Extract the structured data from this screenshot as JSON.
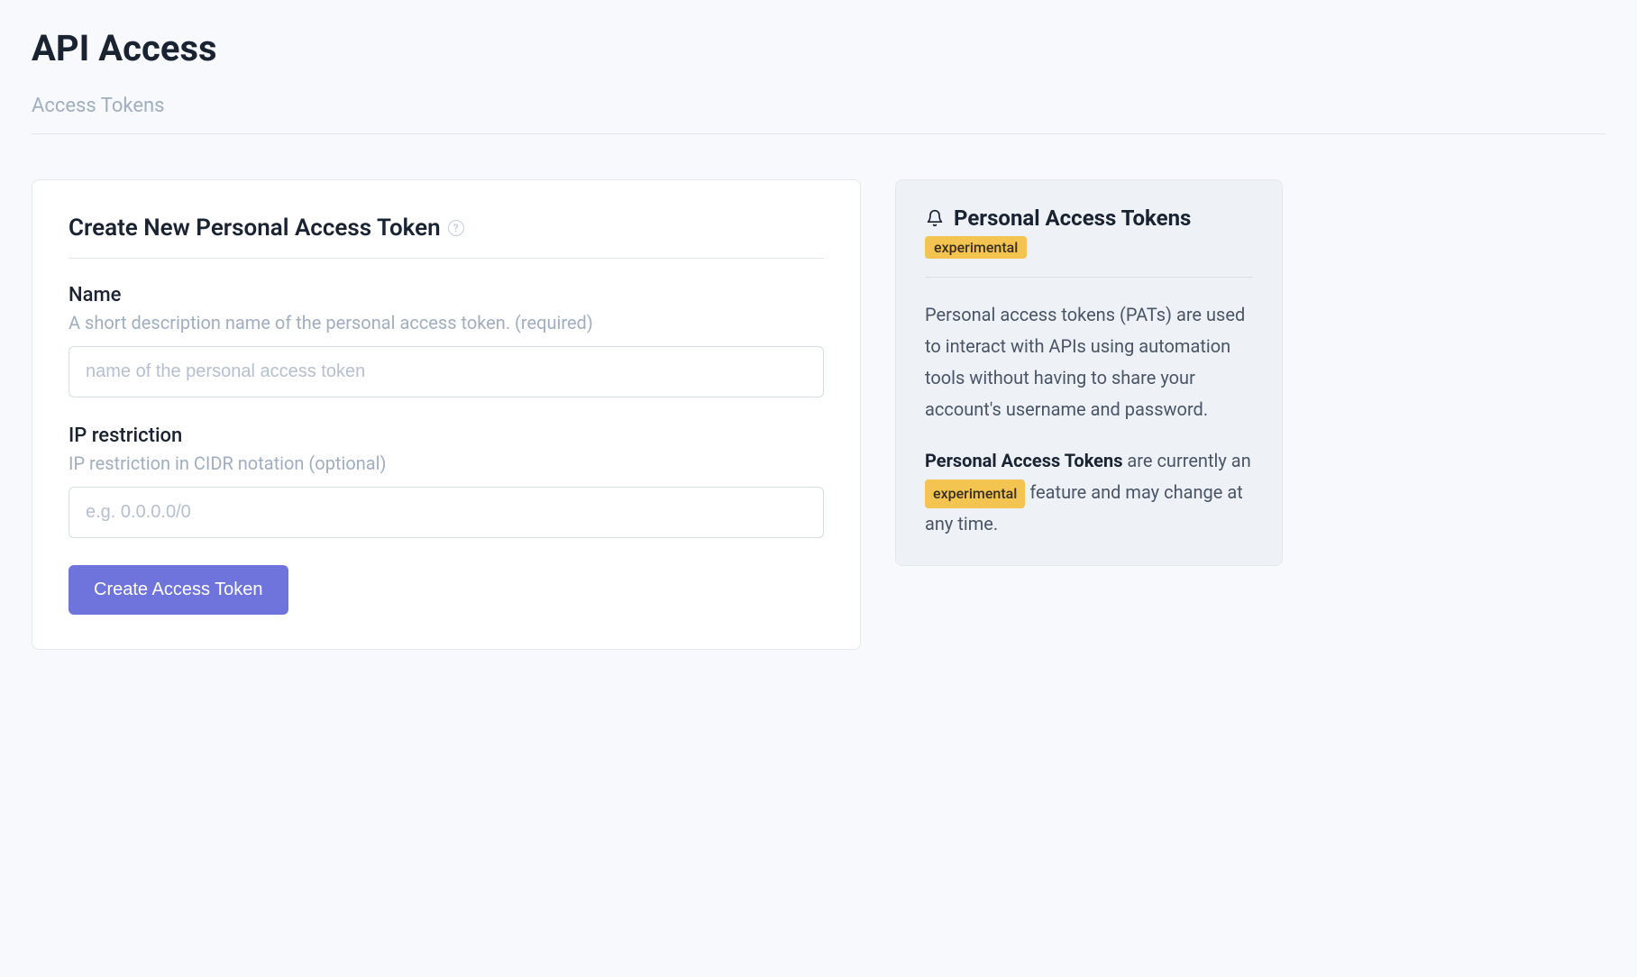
{
  "page": {
    "title": "API Access"
  },
  "tabs": {
    "access_tokens": "Access Tokens"
  },
  "form": {
    "title": "Create New Personal Access Token",
    "help_symbol": "?",
    "name": {
      "label": "Name",
      "help": "A short description name of the personal access token. (required)",
      "placeholder": "name of the personal access token",
      "value": ""
    },
    "ip": {
      "label": "IP restriction",
      "help": "IP restriction in CIDR notation (optional)",
      "placeholder": "e.g. 0.0.0.0/0",
      "value": ""
    },
    "submit_label": "Create Access Token"
  },
  "sidebar": {
    "title": "Personal Access Tokens",
    "badge": "experimental",
    "paragraph1": "Personal access tokens (PATs) are used to interact with APIs using automation tools without having to share your account's username and password.",
    "p2_strong": "Personal Access Tokens",
    "p2_before": " are currently an ",
    "p2_badge": "experimental",
    "p2_after": " feature and may change at any time."
  }
}
